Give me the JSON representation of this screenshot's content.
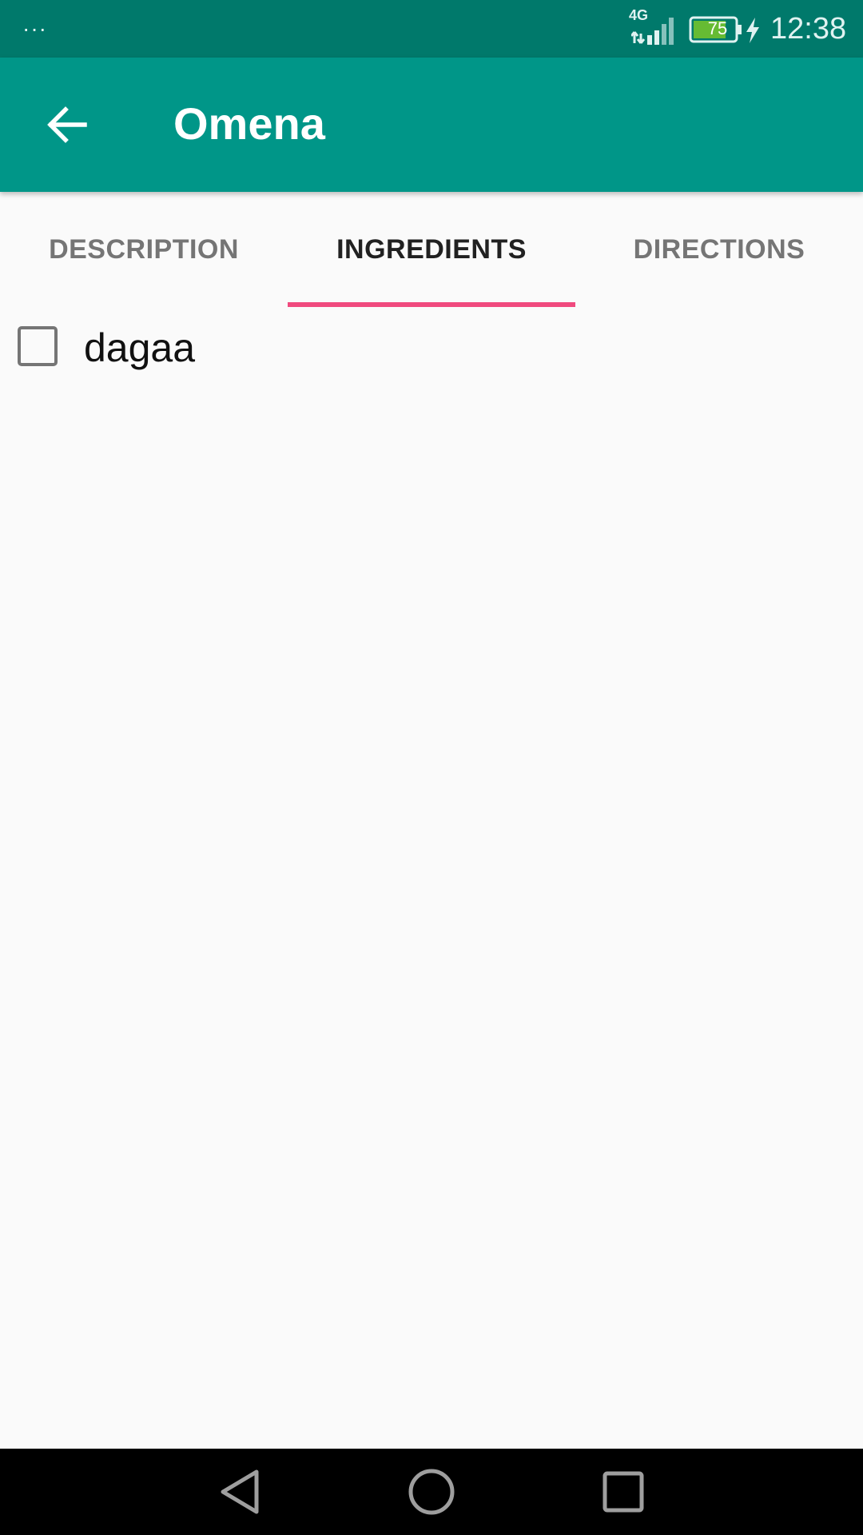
{
  "status_bar": {
    "menu_dots": "···",
    "network_label": "4G",
    "battery_level": "75",
    "time": "12:38"
  },
  "app_bar": {
    "title": "Omena",
    "back_icon": "arrow-back-icon"
  },
  "tabs": [
    {
      "label": "DESCRIPTION",
      "active": false
    },
    {
      "label": "INGREDIENTS",
      "active": true
    },
    {
      "label": "DIRECTIONS",
      "active": false
    }
  ],
  "ingredients": [
    {
      "label": "dagaa",
      "checked": false
    }
  ],
  "nav_bar": {
    "back_icon": "triangle-back-icon",
    "home_icon": "circle-home-icon",
    "recents_icon": "square-recents-icon"
  },
  "colors": {
    "status_bar": "#00796b",
    "app_bar": "#009688",
    "tab_indicator": "#f04a7e",
    "background": "#fafafa"
  }
}
